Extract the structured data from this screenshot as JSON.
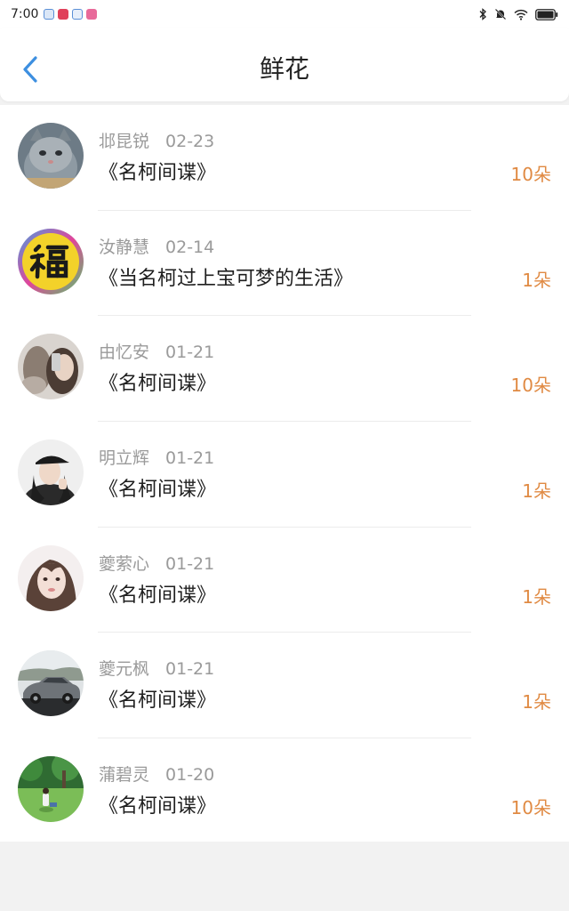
{
  "status_bar": {
    "time": "7:00",
    "app_icons": [
      {
        "icon": "app-notification-icon",
        "color": "#5a8fd6"
      },
      {
        "icon": "app-notification-icon",
        "color": "#e0405a"
      },
      {
        "icon": "app-notification-icon",
        "color": "#5a8fd6"
      },
      {
        "icon": "app-notification-icon",
        "color": "#e86a9a"
      }
    ],
    "system_icons": [
      "bluetooth-icon",
      "mute-icon",
      "wifi-icon",
      "battery-icon"
    ]
  },
  "header": {
    "back_icon": "chevron-left-icon",
    "title": "鲜花",
    "accent_color": "#3d8fe0"
  },
  "colors": {
    "count": "#e08a43",
    "meta": "#9a9a9a"
  },
  "items": [
    {
      "name": "邶昆锐",
      "date": "02-23",
      "book": "《名柯间谍》",
      "count": "10朵",
      "avatar": "cat-photo"
    },
    {
      "name": "汝静慧",
      "date": "02-14",
      "book": "《当名柯过上宝可梦的生活》",
      "count": "1朵",
      "avatar": "fu-character"
    },
    {
      "name": "由忆安",
      "date": "01-21",
      "book": "《名柯间谍》",
      "count": "10朵",
      "avatar": "selfie-photo"
    },
    {
      "name": "明立辉",
      "date": "01-21",
      "book": "《名柯间谍》",
      "count": "1朵",
      "avatar": "girl-in-cap-photo"
    },
    {
      "name": "夔萦心",
      "date": "01-21",
      "book": "《名柯间谍》",
      "count": "1朵",
      "avatar": "girl-portrait-photo"
    },
    {
      "name": "夔元枫",
      "date": "01-21",
      "book": "《名柯间谍》",
      "count": "1朵",
      "avatar": "car-photo"
    },
    {
      "name": "蒲碧灵",
      "date": "01-20",
      "book": "《名柯间谍》",
      "count": "10朵",
      "avatar": "park-photo"
    }
  ]
}
